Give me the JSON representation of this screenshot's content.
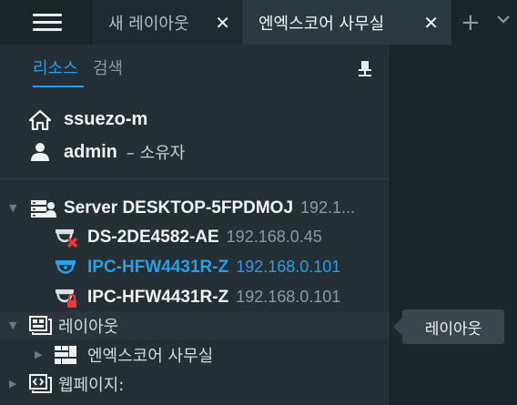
{
  "topbar": {
    "tabs": [
      {
        "label": "새 레이아웃",
        "close": "✕"
      },
      {
        "label": "엔엑스코어 사무실",
        "close": "✕"
      }
    ],
    "add_symbol": "+"
  },
  "panel": {
    "tabs": {
      "resources": "리소스",
      "search": "검색"
    },
    "server_host": "ssuezo-m",
    "user_name": "admin",
    "user_role": "– 소유자",
    "tree": {
      "server": {
        "name": "Server DESKTOP-5FPDMOJ",
        "ip": "192.1..."
      },
      "cameras": [
        {
          "name": "DS-2DE4582-AE",
          "ip": "192.168.0.45",
          "state": "offline"
        },
        {
          "name": "IPC-HFW4431R-Z",
          "ip": "192.168.0.101",
          "state": "selected"
        },
        {
          "name": "IPC-HFW4431R-Z",
          "ip": "192.168.0.101",
          "state": "locked"
        }
      ],
      "layouts_group": "레이아웃",
      "layout_item": "엔엑스코어 사무실",
      "webpages_group": "웹페이지:"
    }
  },
  "tooltip": "레이아웃",
  "colors": {
    "accent": "#2b9ee8",
    "panel": "#232f35",
    "topbar": "#1a252a",
    "error": "#e83a3a"
  },
  "icons": [
    "menu-icon",
    "close-icon",
    "plus-icon",
    "chevron-down-icon",
    "pin-icon",
    "home-icon",
    "user-icon",
    "server-icon",
    "camera-offline-icon",
    "dome-camera-icon",
    "camera-locked-icon",
    "layout-icon",
    "grid-layout-icon",
    "webpage-icon"
  ]
}
